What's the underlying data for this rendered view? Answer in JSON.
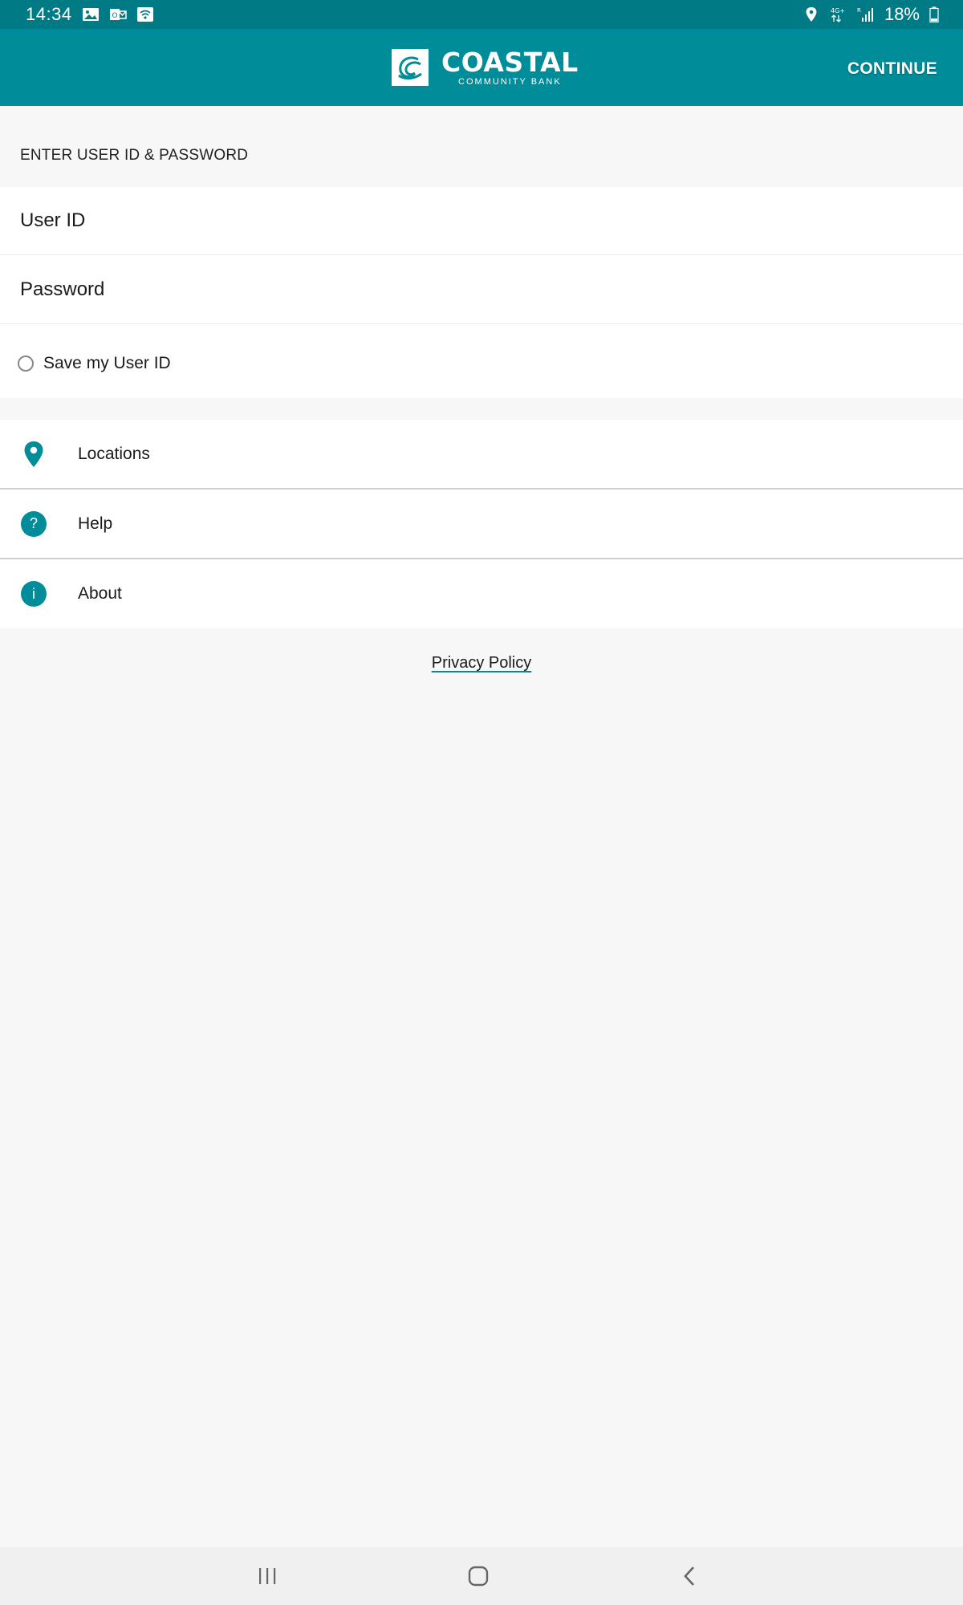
{
  "status_bar": {
    "time": "14:34",
    "battery": "18%",
    "left_icons": [
      "image-icon",
      "outlook-icon",
      "wifi-calling-icon"
    ],
    "right_icons": [
      "location-icon",
      "network-4g-icon",
      "signal-icon",
      "battery-icon"
    ]
  },
  "app_bar": {
    "logo_name": "COASTAL",
    "logo_sub": "COMMUNITY BANK",
    "continue_label": "CONTINUE",
    "color": "#008c99"
  },
  "login": {
    "section_header": "ENTER USER ID & PASSWORD",
    "user_id_placeholder": "User ID",
    "password_placeholder": "Password",
    "save_user_id_label": "Save my User ID"
  },
  "menu": {
    "items": [
      {
        "label": "Locations",
        "icon": "location-pin-icon"
      },
      {
        "label": "Help",
        "icon": "help-icon",
        "glyph": "?"
      },
      {
        "label": "About",
        "icon": "info-icon",
        "glyph": "i"
      }
    ]
  },
  "footer": {
    "privacy_label": "Privacy Policy"
  },
  "nav_bar": {
    "buttons": [
      "recent-apps-icon",
      "home-icon",
      "back-icon"
    ]
  }
}
